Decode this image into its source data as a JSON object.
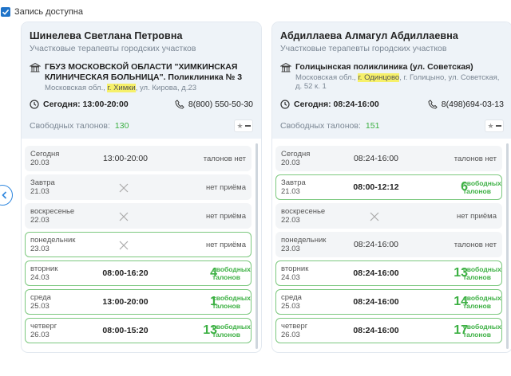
{
  "header": {
    "checkbox_label": "Запись доступна",
    "checked": true
  },
  "colors": {
    "accent": "#1f73c8",
    "available": "#3cb043",
    "card_head": "#eef3f8",
    "highlight": "#f6f06a"
  },
  "icons": {
    "checkbox": "check-icon",
    "prev": "chevron-left-icon",
    "clinic": "building-icon",
    "clock": "clock-icon",
    "phone": "phone-icon",
    "favorite": "star-icon",
    "unavailable": "cross-icon"
  },
  "doctors": [
    {
      "name": "Шинелева Светлана Петровна",
      "role": "Участковые терапевты городских участков",
      "clinic_name": "ГБУЗ МОСКОВСКОЙ ОБЛАСТИ \"ХИМКИНСКАЯ КЛИНИЧЕСКАЯ БОЛЬНИЦА\". Поликлиника № 3",
      "address_pre": "Московская обл., ",
      "address_hl": "г. Химки",
      "address_post": ", ул. Кирова, д.23",
      "today_label": "Сегодня: 13:00-20:00",
      "phone": "8(800) 550-50-30",
      "free_label": "Свободных талонов:",
      "free_count": "130",
      "slots": [
        {
          "day": "Сегодня",
          "date": "20.03",
          "time": "13:00-20:00",
          "status": "талонов нет"
        },
        {
          "day": "Завтра",
          "date": "21.03",
          "time": "",
          "status": "нет приёма"
        },
        {
          "day": "воскресенье",
          "date": "22.03",
          "time": "",
          "status": "нет приёма"
        },
        {
          "day": "понедельник",
          "date": "23.03",
          "time": "",
          "status": "нет приёма"
        },
        {
          "day": "вторник",
          "date": "24.03",
          "time": "08:00-16:20",
          "count": "4",
          "free": "свободных талонов"
        },
        {
          "day": "среда",
          "date": "25.03",
          "time": "13:00-20:00",
          "count": "1",
          "free": "свободных талонов"
        },
        {
          "day": "четверг",
          "date": "26.03",
          "time": "08:00-15:20",
          "count": "13",
          "free": "свободных талонов"
        }
      ]
    },
    {
      "name": "Абдиллаева Алмагул Абдиллаевна",
      "role": "Участковые терапевты городских участков",
      "clinic_name": "Голицынская поликлиника (ул. Советская)",
      "address_pre": "Московская обл., ",
      "address_hl": "г. Одинцово",
      "address_post": ", г. Голицыно, ул. Советская, д. 52 к. 1",
      "today_label": "Сегодня: 08:24-16:00",
      "phone": "8(498)694-03-13",
      "free_label": "Свободных талонов:",
      "free_count": "151",
      "slots": [
        {
          "day": "Сегодня",
          "date": "20.03",
          "time": "08:24-16:00",
          "status": "талонов нет"
        },
        {
          "day": "Завтра",
          "date": "21.03",
          "time": "08:00-12:12",
          "count": "6",
          "free": "свободных талонов"
        },
        {
          "day": "воскресенье",
          "date": "22.03",
          "time": "",
          "status": "нет приёма"
        },
        {
          "day": "понедельник",
          "date": "23.03",
          "time": "08:24-16:00",
          "status": "талонов нет"
        },
        {
          "day": "вторник",
          "date": "24.03",
          "time": "08:24-16:00",
          "count": "13",
          "free": "свободных талонов"
        },
        {
          "day": "среда",
          "date": "25.03",
          "time": "08:24-16:00",
          "count": "14",
          "free": "свободных талонов"
        },
        {
          "day": "четверг",
          "date": "26.03",
          "time": "08:24-16:00",
          "count": "17",
          "free": "свободных талонов"
        }
      ]
    }
  ]
}
